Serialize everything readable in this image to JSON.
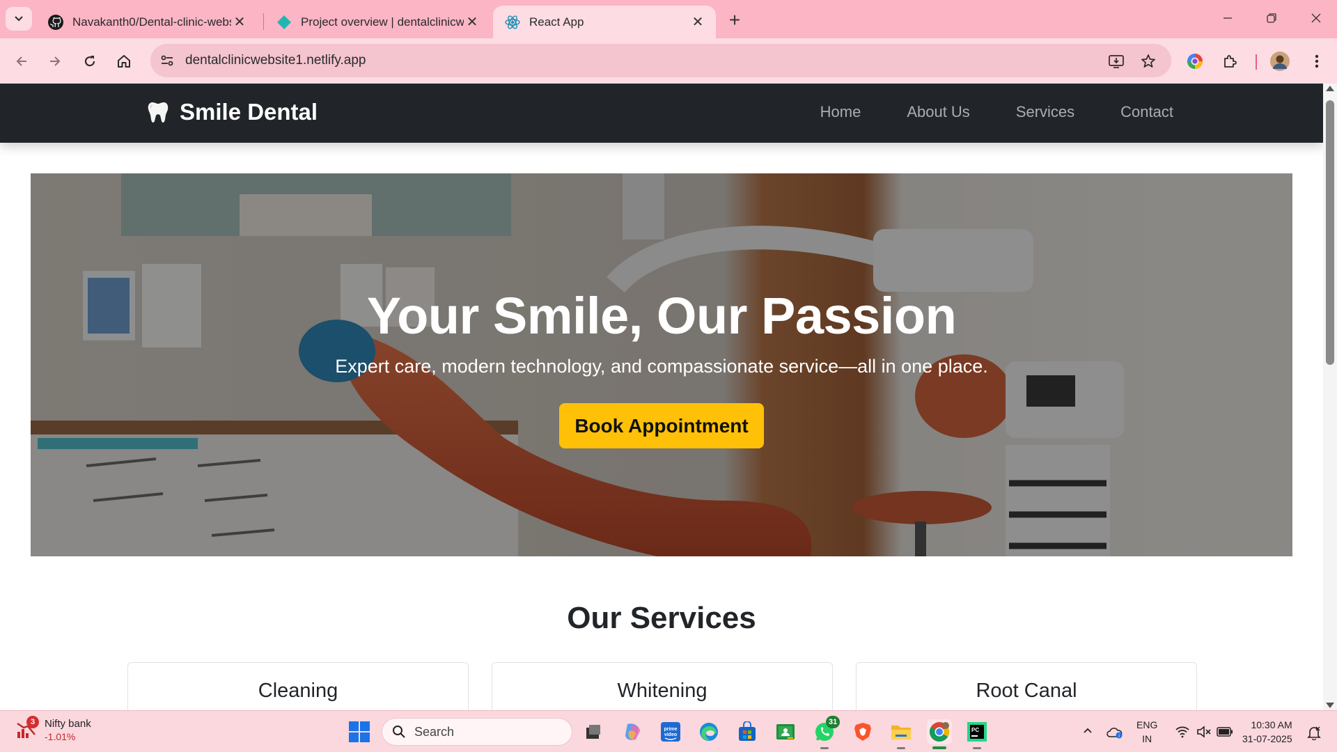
{
  "browser": {
    "tabs": [
      {
        "title": "Navakanth0/Dental-clinic-webs",
        "favicon": "github-icon"
      },
      {
        "title": "Project overview | dentalclinicw",
        "favicon": "netlify-icon"
      },
      {
        "title": "React App",
        "favicon": "react-icon",
        "active": true
      }
    ],
    "url": "dentalclinicwebsite1.netlify.app",
    "theme_colors": {
      "tabstrip": "#fbb5c5",
      "toolbar": "#fddce4"
    }
  },
  "site": {
    "brand": "Smile Dental",
    "brand_icon": "tooth-icon",
    "nav": [
      "Home",
      "About Us",
      "Services",
      "Contact"
    ],
    "hero": {
      "title": "Your Smile, Our Passion",
      "subtitle": "Expert care, modern technology, and compassionate service—all in one place.",
      "cta": "Book Appointment"
    },
    "services_title": "Our Services",
    "services": [
      "Cleaning",
      "Whitening",
      "Root Canal"
    ],
    "colors": {
      "navbar": "#212529",
      "cta": "#ffc107"
    }
  },
  "taskbar": {
    "widget": {
      "name": "Nifty bank",
      "change": "-1.01%",
      "badge": "3"
    },
    "search_placeholder": "Search",
    "whatsapp_badge": "31",
    "language": {
      "line1": "ENG",
      "line2": "IN"
    },
    "time": "10:30 AM",
    "date": "31-07-2025"
  }
}
